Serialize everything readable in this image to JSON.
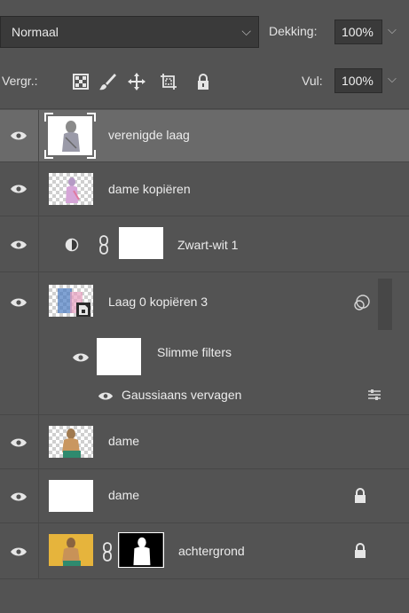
{
  "blend": {
    "mode": "Normaal",
    "opacity_label": "Dekking:",
    "opacity_value": "100%"
  },
  "lock": {
    "label": "Vergr.:",
    "fill_label": "Vul:",
    "fill_value": "100%",
    "icons": [
      "lock-transparent-pixels-icon",
      "lock-image-pixels-icon",
      "lock-position-icon",
      "prevent-auto-nesting-icon",
      "lock-all-icon"
    ]
  },
  "layers": [
    {
      "name": "verenigde laag",
      "selected": true
    },
    {
      "name": "dame kopiëren"
    },
    {
      "name": "Zwart-wit 1",
      "type": "adjustment"
    },
    {
      "name": "Laag 0 kopiëren 3",
      "type": "smart-object"
    },
    {
      "name": "Slimme filters",
      "type": "smart-filters"
    },
    {
      "name": "Gaussiaans vervagen",
      "type": "filter"
    },
    {
      "name": "dame"
    },
    {
      "name": "dame",
      "locked": true
    },
    {
      "name": "achtergrond",
      "locked": true
    }
  ],
  "colors": {
    "panel": "#535353",
    "selected_row": "#6a6a6a",
    "field": "#3a3a3a"
  }
}
